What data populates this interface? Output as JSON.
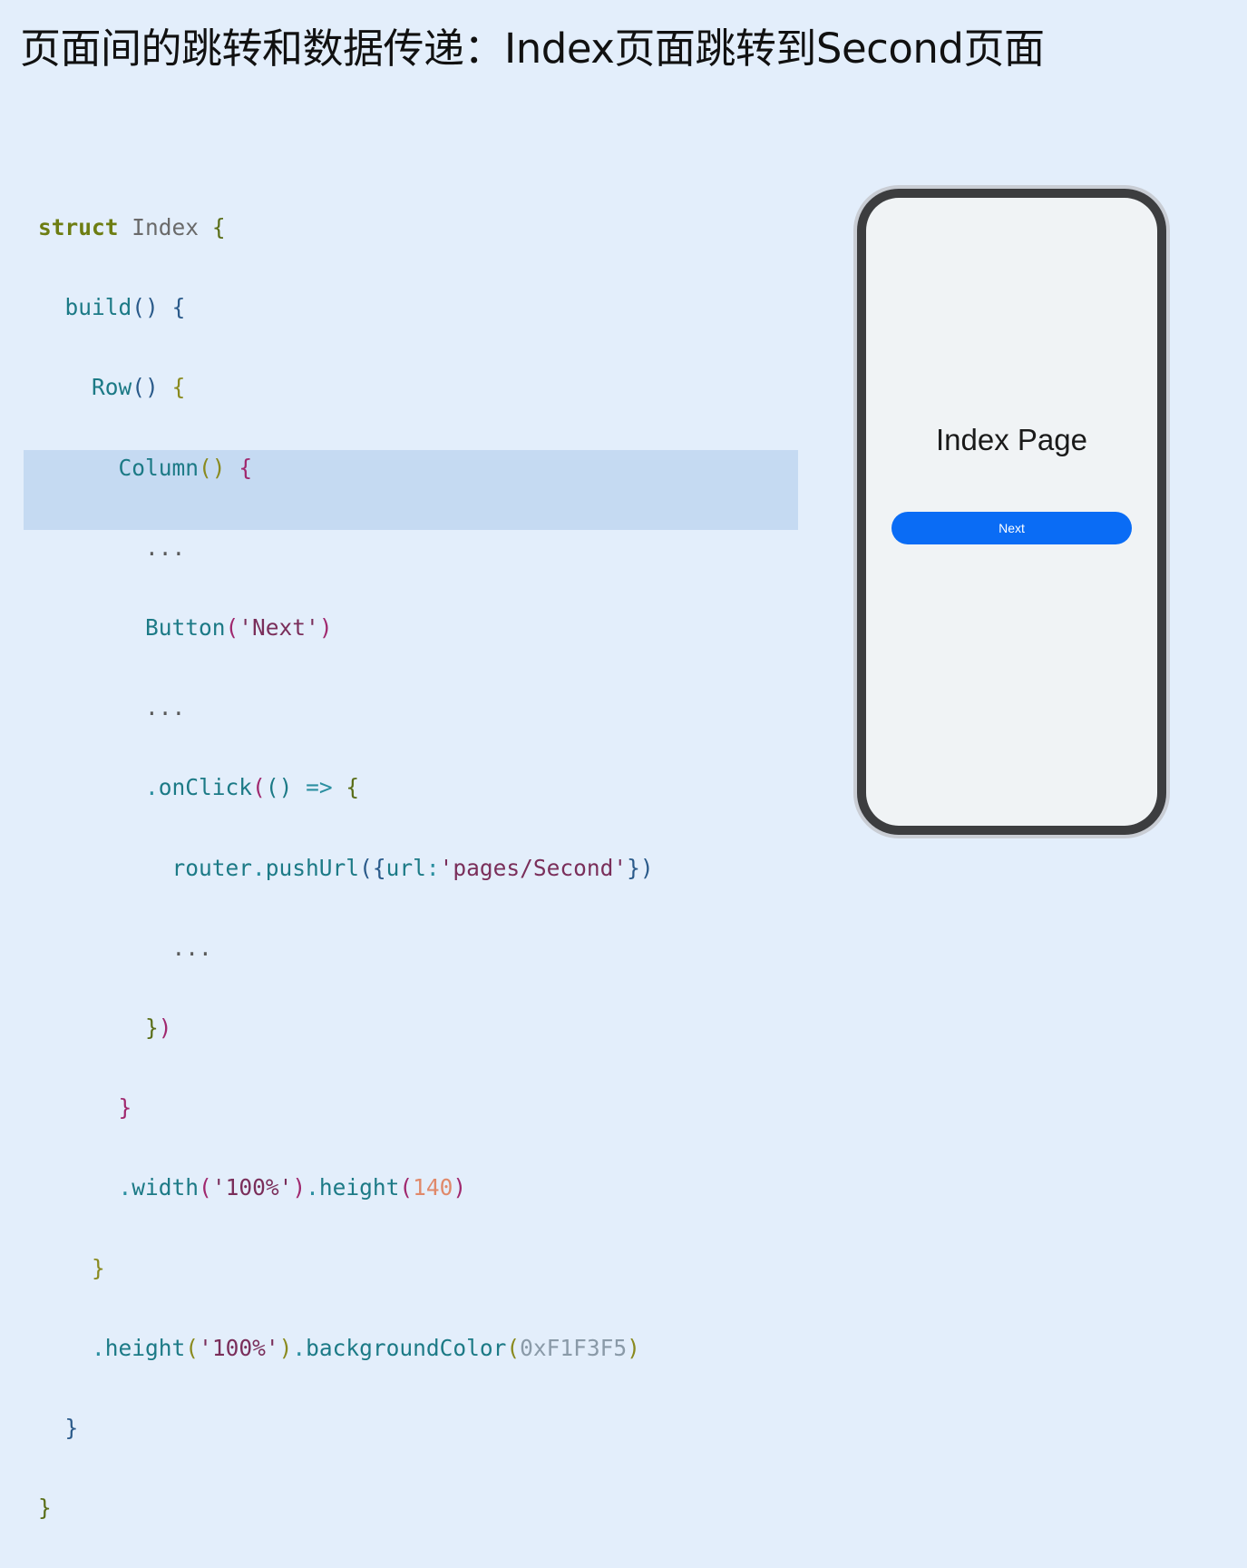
{
  "slide": {
    "title": "页面间的跳转和数据传递：Index页面跳转到Second页面"
  },
  "code": {
    "l1_kw": "struct",
    "l1_name": "Index",
    "l1_brace": "{",
    "l2_fn": "build",
    "l2_parens": "()",
    "l2_brace": "{",
    "l3_fn": "Row",
    "l3_parens": "()",
    "l3_brace": "{",
    "l4_fn": "Column",
    "l4_parens": "()",
    "l4_brace": "{",
    "l5_dots": "...",
    "l6_fn": "Button",
    "l6_open": "(",
    "l6_str": "'Next'",
    "l6_close": ")",
    "l7_dots": "...",
    "l8_dot": ".",
    "l8_fn": "onClick",
    "l8_open": "(",
    "l8_parens": "()",
    "l8_arrow": "=>",
    "l8_brace": "{",
    "l9_obj": "router",
    "l9_dot": ".",
    "l9_fn": "pushUrl",
    "l9_open": "({",
    "l9_key": "url",
    "l9_colon": ":",
    "l9_str": "'pages/Second'",
    "l9_close": "})",
    "l10_dots": "...",
    "l11_close_brace": "}",
    "l11_close_paren": ")",
    "l12_brace": "}",
    "l13_dot1": ".",
    "l13_fn1": "width",
    "l13_open1": "(",
    "l13_str": "'100%'",
    "l13_close1": ")",
    "l13_dot2": ".",
    "l13_fn2": "height",
    "l13_open2": "(",
    "l13_num": "140",
    "l13_close2": ")",
    "l14_brace": "}",
    "l15_dot1": ".",
    "l15_fn1": "height",
    "l15_open1": "(",
    "l15_str": "'100%'",
    "l15_close1": ")",
    "l15_dot2": ".",
    "l15_fn2": "backgroundColor",
    "l15_open2": "(",
    "l15_hex": "0xF1F3F5",
    "l15_close2": ")",
    "l16_brace": "}",
    "l17_brace": "}"
  },
  "phone": {
    "page_heading": "Index Page",
    "next_button_label": "Next"
  },
  "colors": {
    "background": "#e3eefb",
    "highlight": "#c5daf2",
    "button": "#0a6cf5",
    "screen": "#f0f3f5"
  }
}
